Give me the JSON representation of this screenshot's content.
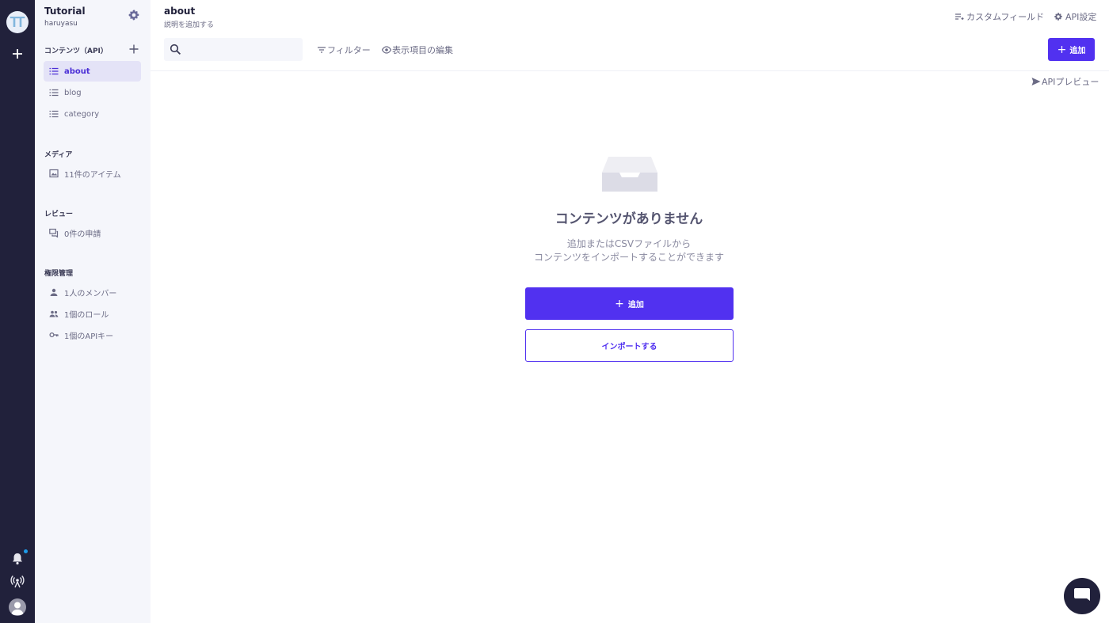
{
  "rail": {
    "service_initials": "TT",
    "icons": [
      "add-service-icon",
      "bell-icon",
      "broadcast-icon",
      "user-avatar"
    ]
  },
  "sidebar": {
    "service_name": "Tutorial",
    "service_id": "haruyasu",
    "content_section": "コンテンツ（API）",
    "content_items": [
      {
        "label": "about",
        "active": true
      },
      {
        "label": "blog",
        "active": false
      },
      {
        "label": "category",
        "active": false
      }
    ],
    "media_section": "メディア",
    "media_item": "11件のアイテム",
    "review_section": "レビュー",
    "review_item": "0件の申請",
    "permission_section": "権限管理",
    "permission_items": [
      "1人のメンバー",
      "1個のロール",
      "1個のAPIキー"
    ]
  },
  "header": {
    "title": "about",
    "description": "説明を追加する",
    "custom_field": "カスタムフィールド",
    "api_settings": "API設定"
  },
  "toolbar": {
    "search_placeholder": "",
    "filter": "フィルター",
    "edit_columns": "表示項目の編集",
    "add_button": "追加"
  },
  "api_preview": "APIプレビュー",
  "empty_state": {
    "title": "コンテンツがありません",
    "line1": "追加またはCSVファイルから",
    "line2": "コンテンツをインポートすることができます",
    "add_button": "追加",
    "import_button": "インポートする"
  },
  "colors": {
    "accent": "#5131f0",
    "rail": "#21213b",
    "sidebar": "#f5f6fb"
  }
}
